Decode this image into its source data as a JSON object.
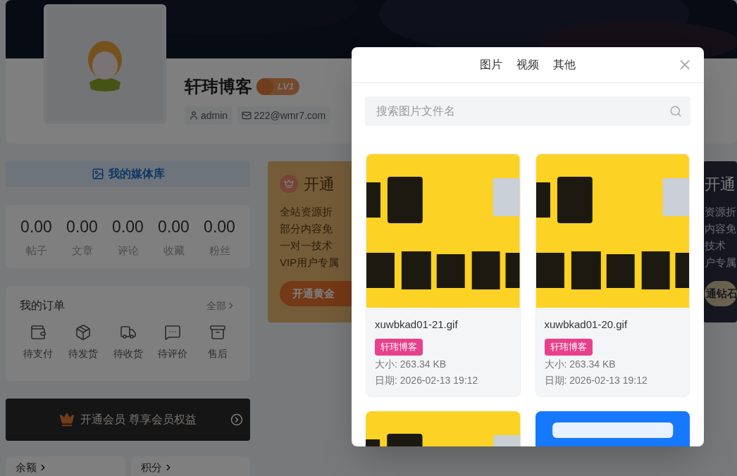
{
  "profile": {
    "name": "轩玮博客",
    "level": "LV1",
    "username": "admin",
    "email": "222@wmr7.com"
  },
  "media_library_button": "我的媒体库",
  "stats": [
    {
      "value": "0.00",
      "label": "帖子"
    },
    {
      "value": "0.00",
      "label": "文章"
    },
    {
      "value": "0.00",
      "label": "评论"
    },
    {
      "value": "0.00",
      "label": "收藏"
    },
    {
      "value": "0.00",
      "label": "粉丝"
    }
  ],
  "orders": {
    "title": "我的订单",
    "all_link": "全部",
    "items": [
      "待支付",
      "待发货",
      "待收货",
      "待评价",
      "售后"
    ]
  },
  "vip_banner": "开通会员 尊享会员权益",
  "bottom_cards": [
    "余额",
    "积分"
  ],
  "gold_card": {
    "title": "开通",
    "lines": [
      "全站资源折",
      "部分内容免",
      "一对一技术",
      "VIP用户专属"
    ],
    "button": "开通黄金"
  },
  "diamond_card": {
    "title": "开通",
    "lines": [
      "资源折",
      "内容免",
      "技术",
      "户专属"
    ],
    "button": "通钻石"
  },
  "media_dialog": {
    "tabs": [
      "图片",
      "视频",
      "其他"
    ],
    "search": {
      "placeholder": "搜索图片文件名"
    },
    "files": [
      {
        "kind": "file",
        "name": "xuwbkad01-21.gif",
        "tag": "轩玮博客",
        "size": "大小: 263.34 KB",
        "date": "日期: 2026-02-13 19:12"
      },
      {
        "kind": "file",
        "name": "xuwbkad01-20.gif",
        "tag": "轩玮博客",
        "size": "大小: 263.34 KB",
        "date": "日期: 2026-02-13 19:12"
      },
      {
        "kind": "picture"
      },
      {
        "kind": "picture"
      }
    ]
  }
}
